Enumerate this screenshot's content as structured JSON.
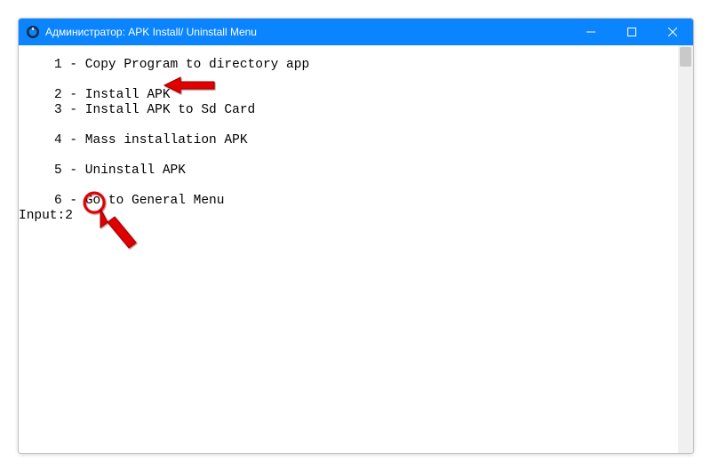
{
  "window": {
    "title": "Администратор:  APK Install/ Uninstall Menu"
  },
  "menu": {
    "item1": "1 - Copy Program to directory app",
    "item2": "2 - Install APK",
    "item3": "3 - Install APK to Sd Card",
    "item4": "4 - Mass installation APK",
    "item5": "5 - Uninstall APK",
    "item6": "6 - Go to General Menu"
  },
  "prompt": {
    "label": "Input:",
    "value": "2"
  },
  "annotations": {
    "arrow_to_item2": "arrow",
    "circle_on_value": "circle"
  }
}
